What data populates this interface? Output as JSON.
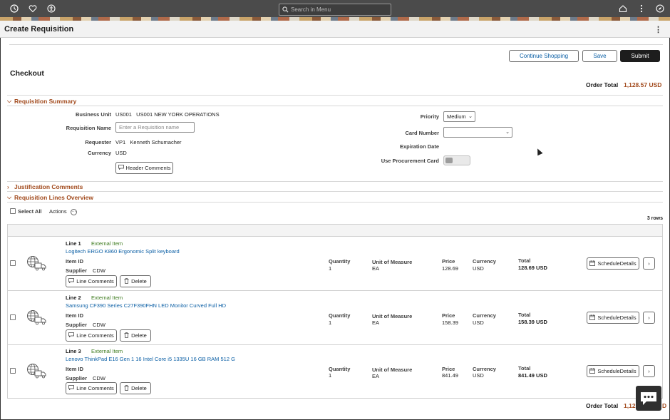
{
  "topbar": {
    "search_placeholder": "Search in Menu",
    "icons": [
      "recent-icon",
      "favorites-icon",
      "accessibility-icon",
      "home-icon",
      "more-icon",
      "navigator-icon"
    ]
  },
  "page": {
    "title": "Create Requisition",
    "kebab": "⋮"
  },
  "actions": {
    "continue_shopping": "Continue Shopping",
    "save": "Save",
    "submit": "Submit"
  },
  "checkout": {
    "heading": "Checkout",
    "order_total_label": "Order Total",
    "order_total_value": "1,128.57 USD",
    "bottom_total_visible": "1,12",
    "bottom_total_tail": "D"
  },
  "summary": {
    "section_label": "Requisition Summary",
    "business_unit_label": "Business Unit",
    "business_unit_value": "US001   US001 NEW YORK OPERATIONS",
    "requisition_name_label": "Requisition Name",
    "requisition_name_placeholder": "Enter a Requisition name",
    "requester_label": "Requester",
    "requester_value": "VP1   Kenneth Schumacher",
    "currency_label": "Currency",
    "currency_value": "USD",
    "header_comments": "Header Comments",
    "priority_label": "Priority",
    "priority_value": "Medium",
    "card_number_label": "Card Number",
    "card_number_value": "",
    "expiration_label": "Expiration Date",
    "procurement_label": "Use Procurement Card"
  },
  "justification": {
    "section_label": "Justification Comments"
  },
  "lines_overview": {
    "section_label": "Requisition Lines Overview",
    "select_all": "Select All",
    "actions": "Actions",
    "rows_count": "3 rows",
    "labels": {
      "item_id": "Item ID",
      "supplier": "Supplier",
      "quantity": "Quantity",
      "uom": "Unit of Measure",
      "price": "Price",
      "currency": "Currency",
      "total": "Total",
      "line_comments": "Line Comments",
      "delete": "Delete",
      "schedule_details": "ScheduleDetails"
    },
    "lines": [
      {
        "line": "Line 1",
        "type": "External Item",
        "desc": "Logitech ERGO K860 Ergonomic Split keyboard",
        "supplier": "CDW",
        "quantity": "1",
        "uom": "EA",
        "price": "128.69",
        "currency": "USD",
        "total": "128.69 USD"
      },
      {
        "line": "Line 2",
        "type": "External Item",
        "desc": "Samsung CF390 Series C27F390FHN LED Monitor Curved Full HD",
        "supplier": "CDW",
        "quantity": "1",
        "uom": "EA",
        "price": "158.39",
        "currency": "USD",
        "total": "158.39 USD"
      },
      {
        "line": "Line 3",
        "type": "External Item",
        "desc": "Lenovo ThinkPad E16 Gen 1 16 Intel Core i5 1335U 16 GB RAM 512 G",
        "supplier": "CDW",
        "quantity": "1",
        "uom": "EA",
        "price": "841.49",
        "currency": "USD",
        "total": "841.49 USD"
      }
    ]
  },
  "colors": {
    "section_accent": "#a24b1e",
    "link": "#0b5fa5",
    "external_item": "#3c7a1d",
    "topbar": "#4b4b4b"
  }
}
